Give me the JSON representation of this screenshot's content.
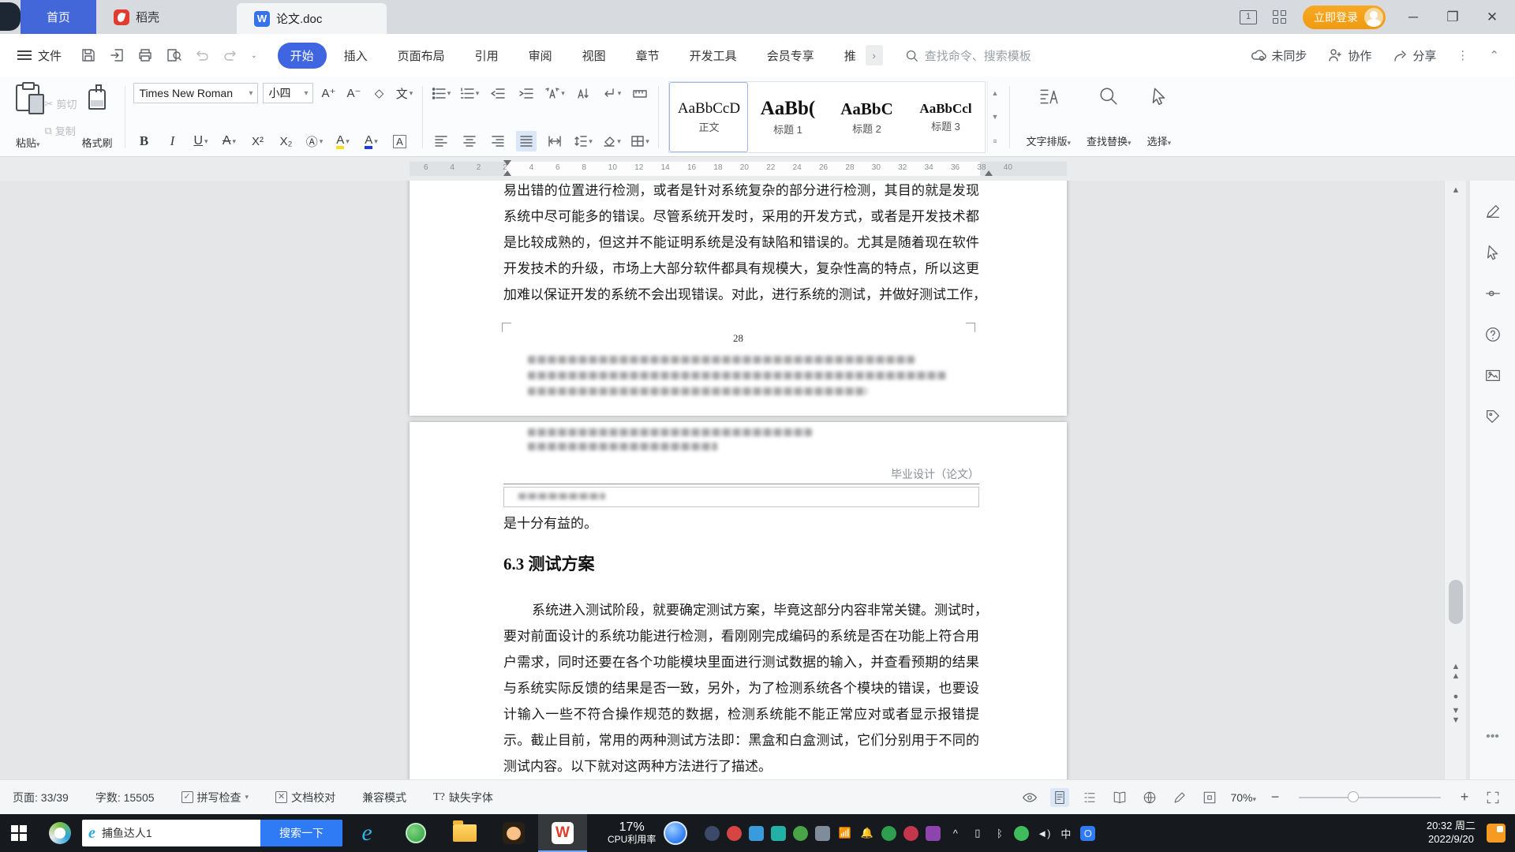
{
  "titlebar": {
    "tabs": [
      {
        "label": "首页"
      },
      {
        "label": "稻壳"
      },
      {
        "label": "论文.doc"
      }
    ],
    "login_label": "立即登录"
  },
  "menubar": {
    "file_label": "文件",
    "tabs": [
      "开始",
      "插入",
      "页面布局",
      "引用",
      "审阅",
      "视图",
      "章节",
      "开发工具",
      "会员专享",
      "推"
    ],
    "active_tab": "开始",
    "overflow_chevron": "›",
    "search_placeholder": "查找命令、搜索模板",
    "sync_label": "未同步",
    "collab_label": "协作",
    "share_label": "分享"
  },
  "toolbar": {
    "paste_label": "粘贴",
    "cut_label": "剪切",
    "copy_label": "复制",
    "format_painter_label": "格式刷",
    "font_name": "Times New Roman",
    "font_size": "小四",
    "glyphs": {
      "grow": "A⁺",
      "shrink": "A⁻",
      "clear": "◇",
      "phonetic": "文",
      "bold": "B",
      "italic": "I",
      "underline": "U",
      "strike": "A",
      "superscript": "X²",
      "subscript": "X₂",
      "enclose": "Ⓐ",
      "highlight": "A",
      "fontcolor": "A",
      "charborder": "A"
    },
    "styles": [
      {
        "sample": "AaBbCcD",
        "name": "正文"
      },
      {
        "sample": "AaBb(",
        "name": "标题 1"
      },
      {
        "sample": "AaBbC",
        "name": "标题 2"
      },
      {
        "sample": "AaBbCcl",
        "name": "标题 3"
      }
    ],
    "text_layout_label": "文字排版",
    "find_replace_label": "查找替换",
    "select_label": "选择"
  },
  "ruler": {
    "left_numbers": [
      "6",
      "4",
      "2"
    ],
    "numbers": [
      "2",
      "4",
      "6",
      "8",
      "10",
      "12",
      "14",
      "16",
      "18",
      "20",
      "22",
      "24",
      "26",
      "28",
      "30",
      "32",
      "34",
      "36",
      "38",
      "40"
    ]
  },
  "document": {
    "page1": {
      "lines": [
        "易出错的位置进行检测，或者是针对系统复杂的部分进行检测，其目的就是发现",
        "系统中尽可能多的错误。尽管系统开发时，采用的开发方式，或者是开发技术都",
        "是比较成熟的，但这并不能证明系统是没有缺陷和错误的。尤其是随着现在软件",
        "开发技术的升级，市场上大部分软件都具有规模大，复杂性高的特点，所以这更",
        "加难以保证开发的系统不会出现错误。对此，进行系统的测试，并做好测试工作，"
      ],
      "page_number": "28"
    },
    "page2": {
      "header": "毕业设计（论文）",
      "para_end": "是十分有益的。",
      "heading": "6.3 测试方案",
      "body_lines": [
        "系统进入测试阶段，就要确定测试方案，毕竟这部分内容非常关键。测试时，",
        "要对前面设计的系统功能进行检测，看刚刚完成编码的系统是否在功能上符合用",
        "户需求，同时还要在各个功能模块里面进行测试数据的输入，并查看预期的结果",
        "与系统实际反馈的结果是否一致，另外，为了检测系统各个模块的错误，也要设",
        "计输入一些不符合操作规范的数据，检测系统能不能正常应对或者显示报错提",
        "示。截止目前，常用的两种测试方法即：黑盒和白盒测试，它们分别用于不同的",
        "测试内容。以下就对这两种方法进行了描述。"
      ]
    }
  },
  "statusbar": {
    "page_info": "页面: 33/39",
    "word_count": "字数: 15505",
    "spell_check": "拼写检查",
    "proofread": "文档校对",
    "compat_mode": "兼容模式",
    "missing_font": "缺失字体",
    "missing_font_glyph": "T?",
    "zoom_level": "70%"
  },
  "taskbar": {
    "search_text": "捕鱼达人1",
    "search_button": "搜索一下",
    "cpu_percent": "17%",
    "cpu_label": "CPU利用率",
    "time": "20:32 周二",
    "date": "2022/9/20",
    "tray": [
      {
        "name": "tray-icon-1",
        "bg": "#3b4a6b",
        "glyph": "",
        "round": true
      },
      {
        "name": "tray-icon-2",
        "bg": "#d64541",
        "glyph": "",
        "round": true
      },
      {
        "name": "tray-icon-3",
        "bg": "#3a9bdc",
        "glyph": ""
      },
      {
        "name": "tray-icon-4",
        "bg": "#23b0a5",
        "glyph": ""
      },
      {
        "name": "tray-icon-5",
        "bg": "#47a447",
        "glyph": "",
        "round": true
      },
      {
        "name": "tray-icon-6",
        "bg": "#7f8c99",
        "glyph": ""
      },
      {
        "name": "network-icon",
        "bg": "transparent",
        "glyph": "📶"
      },
      {
        "name": "bell-icon",
        "bg": "transparent",
        "glyph": "🔔"
      },
      {
        "name": "tray-icon-9",
        "bg": "#2e9e4f",
        "glyph": "",
        "round": true
      },
      {
        "name": "tray-icon-10",
        "bg": "#c4364d",
        "glyph": "",
        "round": true
      },
      {
        "name": "tray-icon-11",
        "bg": "#8e44ad",
        "glyph": ""
      },
      {
        "name": "hidden-icons-chevron",
        "bg": "transparent",
        "glyph": "^"
      },
      {
        "name": "phone-icon",
        "bg": "transparent",
        "glyph": "▯"
      },
      {
        "name": "bluetooth-icon",
        "bg": "transparent",
        "glyph": "ᛒ"
      },
      {
        "name": "wechat-icon",
        "bg": "#3dbd5b",
        "glyph": "",
        "round": true
      },
      {
        "name": "volume-icon",
        "bg": "transparent",
        "glyph": "◄)"
      },
      {
        "name": "input-method-indicator",
        "bg": "transparent",
        "glyph": "中"
      },
      {
        "name": "tray-icon-18",
        "bg": "#2f7bf5",
        "glyph": "O"
      }
    ]
  }
}
